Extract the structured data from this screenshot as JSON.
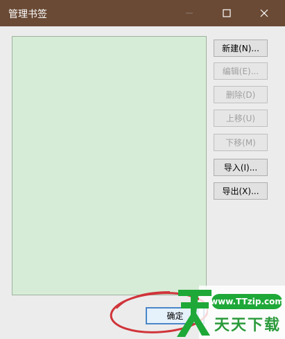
{
  "window": {
    "title": "管理书签"
  },
  "title_buttons": {
    "minimize_icon": "minimize-icon",
    "maximize_icon": "maximize-icon",
    "close_icon": "close-icon"
  },
  "buttons": {
    "new": "新建(N)...",
    "edit": "编辑(E)...",
    "delete": "删除(D)",
    "move_up": "上移(U)",
    "move_down": "下移(M)",
    "import": "导入(I)...",
    "export": "导出(X)...",
    "ok": "确定"
  },
  "watermark": {
    "url": "www.TTzip.com",
    "name": "天天下载"
  },
  "colors": {
    "titlebar": "#6a4a35",
    "list_background": "#d6ecd6",
    "annotation_circle": "#d0343a",
    "watermark_green": "#1ea838"
  }
}
